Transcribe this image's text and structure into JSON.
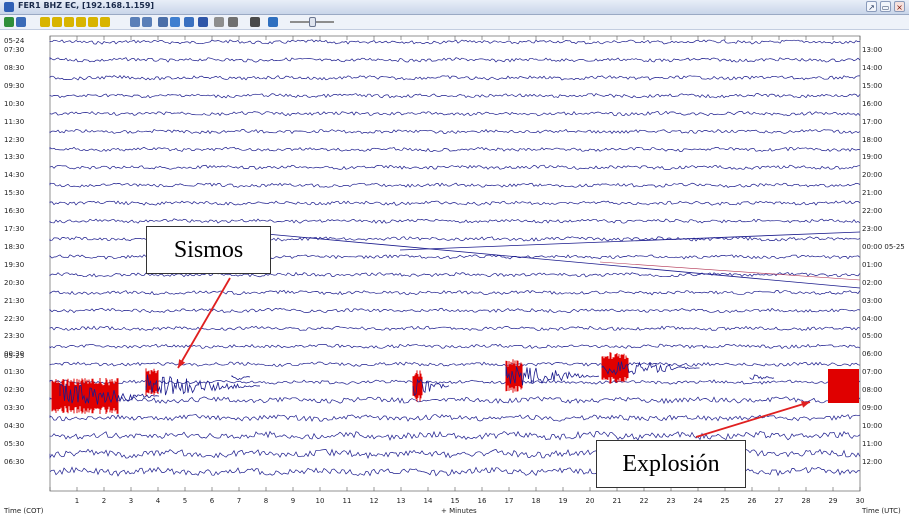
{
  "window": {
    "title": "FER1 BHZ EC, [192.168.1.159]"
  },
  "toolbar": {
    "buttons": [
      {
        "icon": "export-icon",
        "color": "#2f8f3a"
      },
      {
        "icon": "copy-icon",
        "color": "#3b6bb8"
      },
      {
        "icon": "rewind-icon",
        "color": "#d8b400"
      },
      {
        "icon": "back-icon",
        "color": "#d8b400"
      },
      {
        "icon": "forward-icon",
        "color": "#d8b400"
      },
      {
        "icon": "fast-forward-icon",
        "color": "#d8b400"
      },
      {
        "icon": "hourglass-icon",
        "color": "#d8b400"
      },
      {
        "icon": "target-icon",
        "color": "#d8b400"
      },
      {
        "icon": "zoom-in-icon",
        "color": "#5a7fb8"
      },
      {
        "icon": "zoom-out-icon",
        "color": "#5a7fb8"
      },
      {
        "icon": "select-icon",
        "color": "#4a6ea8"
      },
      {
        "icon": "grid-icon",
        "color": "#3f7fd0"
      },
      {
        "icon": "spectrum-icon",
        "color": "#3a70c0"
      },
      {
        "icon": "filter-icon",
        "color": "#2f56a8"
      },
      {
        "icon": "clipboard-icon",
        "color": "#8e8e8e"
      },
      {
        "icon": "delete-icon",
        "color": "#707070"
      },
      {
        "icon": "people-icon",
        "color": "#4a4a4a"
      },
      {
        "icon": "refresh-icon",
        "color": "#2f6fbf"
      }
    ]
  },
  "left_axis": {
    "date_top": "05-24",
    "date_mid": "05-25",
    "labels": [
      "07:30",
      "08:30",
      "09:30",
      "10:30",
      "11:30",
      "12:30",
      "13:30",
      "14:30",
      "15:30",
      "16:30",
      "17:30",
      "18:30",
      "19:30",
      "20:30",
      "21:30",
      "22:30",
      "23:30",
      "00:30",
      "01:30",
      "02:30",
      "03:30",
      "04:30",
      "05:30",
      "06:30"
    ]
  },
  "right_axis": {
    "labels": [
      "13:00",
      "14:00",
      "15:00",
      "16:00",
      "17:00",
      "18:00",
      "19:00",
      "20:00",
      "21:00",
      "22:00",
      "23:00",
      "00:00 05-25",
      "01:00",
      "02:00",
      "03:00",
      "04:00",
      "05:00",
      "06:00",
      "07:00",
      "08:00",
      "09:00",
      "10:00",
      "11:00",
      "12:00"
    ]
  },
  "x_axis": {
    "ticks": [
      "1",
      "2",
      "3",
      "4",
      "5",
      "6",
      "7",
      "8",
      "9",
      "10",
      "11",
      "12",
      "13",
      "14",
      "15",
      "16",
      "17",
      "18",
      "19",
      "20",
      "21",
      "22",
      "23",
      "24",
      "25",
      "26",
      "27",
      "28",
      "29",
      "30"
    ],
    "left_title": "Time (COT)",
    "center_title": "+ Minutes",
    "right_title": "Time (UTC)"
  },
  "annotations": {
    "sismos": "Sismos",
    "explosion": "Explosión"
  },
  "colors": {
    "trace": "#1a1a8c",
    "event": "#e00000",
    "arrow": "#e02020"
  }
}
